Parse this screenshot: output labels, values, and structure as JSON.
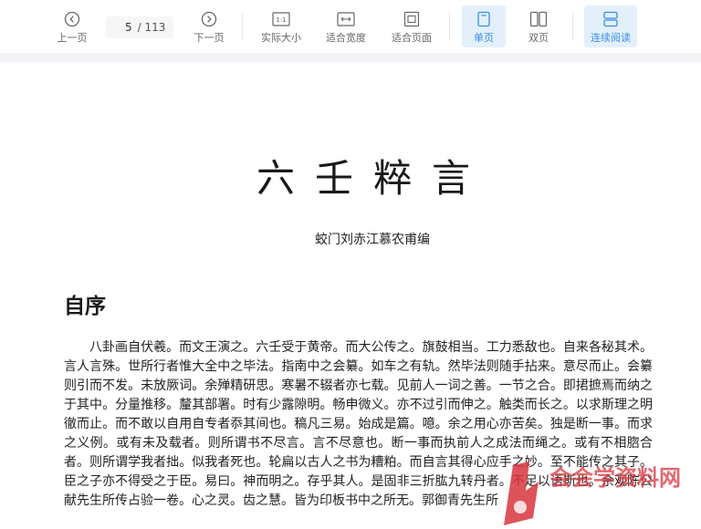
{
  "toolbar": {
    "prev_label": "上一页",
    "next_label": "下一页",
    "page_current": "5",
    "page_total": "/ 113",
    "actual_size_label": "实际大小",
    "fit_width_label": "适合宽度",
    "fit_page_label": "适合页面",
    "single_page_label": "单页",
    "double_page_label": "双页",
    "continuous_label": "连续阅读",
    "actual_size_icon_text": "1:1"
  },
  "document": {
    "title": "六壬粹言",
    "author": "蛟门刘赤江慕农甫编",
    "section_title": "自序",
    "body": "八卦画自伏羲。而文王演之。六壬受于黄帝。而大公传之。旗鼓相当。工力悉敌也。自来各秘其术。言人言殊。世所行者惟大全中之毕法。指南中之会纂。如车之有轨。然毕法则随手拈来。意尽而止。会纂则引而不发。未放厥词。余殚精研思。寒暑不辍者亦七载。见前人一词之善。一节之合。即捃摭焉而纳之于其中。分量推移。釐其部署。时有少露隙明。畅申微义。亦不过引而伸之。触类而长之。以求斯理之明徹而止。而不敢以自用自专者忝其间也。稿凡三易。始成是篇。噫。余之用心亦苦矣。独是断一事。而求之义例。或有未及载者。则所谓书不尽言。言不尽意也。断一事而执前人之成法而绳之。或有不相脗合者。则所谓学我者拙。似我者死也。轮扁以古人之书为糟粕。而自言其得心应手之妙。至不能传之其子。臣之子亦不得受之于臣。易曰。神而明之。存乎其人。是固非三折肱九转丹者。不足以语斯也。余观陈公献先生所传占验一卷。心之灵。齿之慧。皆为印板书中之所无。郭御青先生所"
  },
  "watermark": {
    "text": "会会学资料网"
  },
  "colors": {
    "accent": "#3a8ee6",
    "active_bg": "#e3f0fb",
    "watermark_red": "#d9363e"
  }
}
